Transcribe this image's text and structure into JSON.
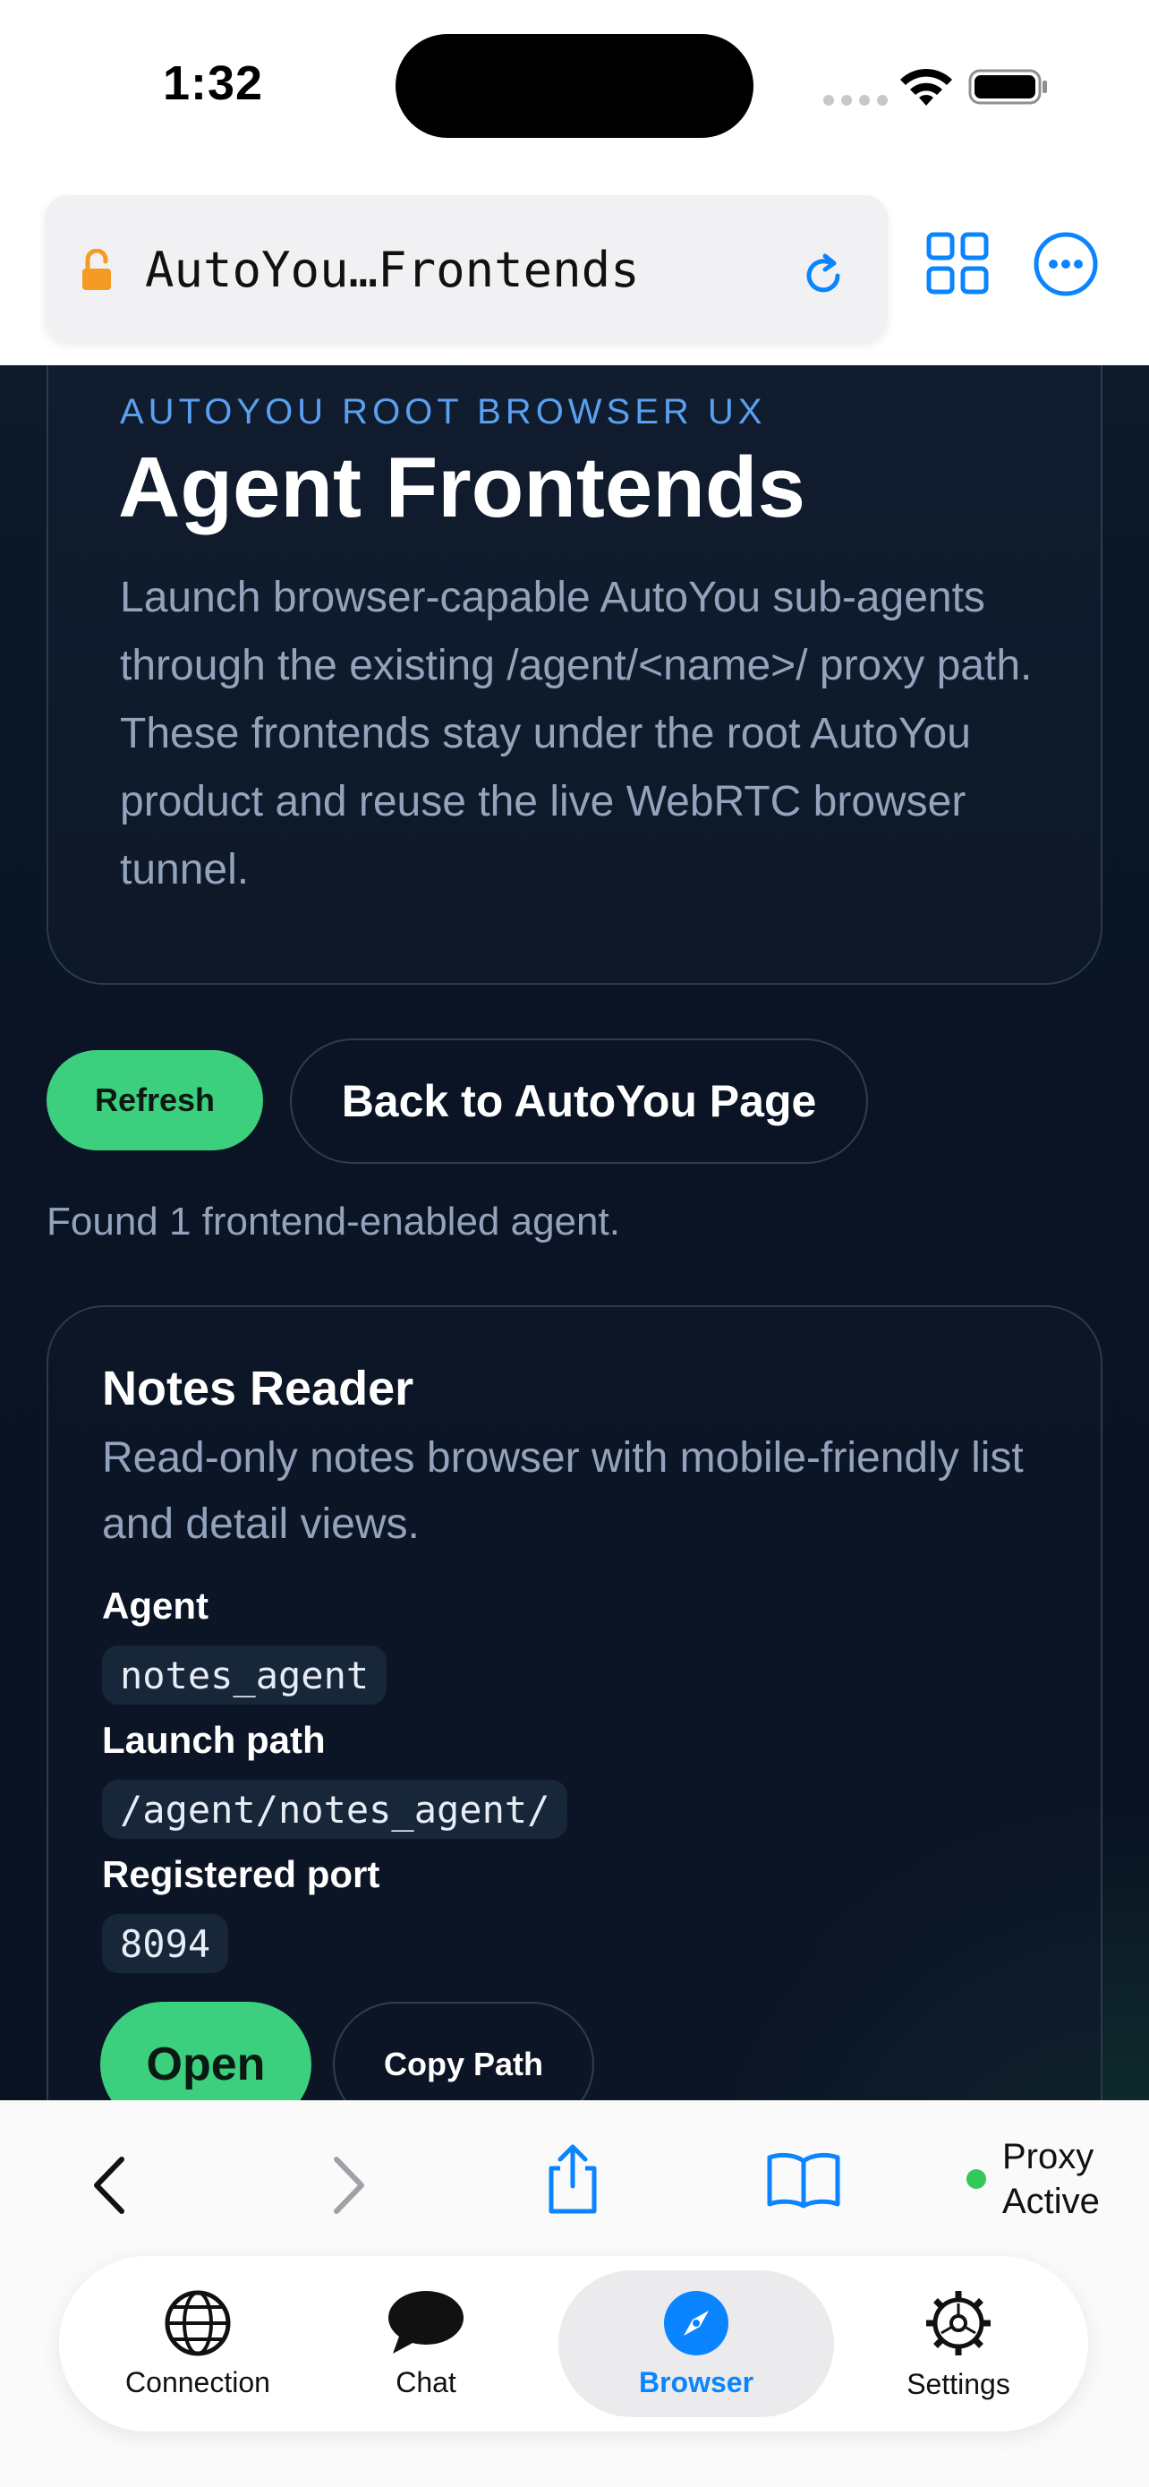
{
  "status_bar": {
    "time": "1:32"
  },
  "url_bar": {
    "url_text": "AutoYou…Frontends"
  },
  "hero": {
    "eyebrow": "AUTOYOU ROOT BROWSER UX",
    "title": "Agent Frontends",
    "description": "Launch browser-capable AutoYou sub-agents through the existing /agent/<name>/ proxy path. These frontends stay under the root AutoYou product and reuse the live WebRTC browser tunnel."
  },
  "actions": {
    "refresh_label": "Refresh",
    "back_label": "Back to AutoYou Page"
  },
  "found_text": "Found 1 frontend-enabled agent.",
  "agent_card": {
    "name": "Notes Reader",
    "description": "Read-only notes browser with mobile-friendly list and detail views.",
    "agent_label": "Agent",
    "agent_value": "notes_agent",
    "launch_path_label": "Launch path",
    "launch_path_value": "/agent/notes_agent/",
    "port_label": "Registered port",
    "port_value": "8094",
    "open_label": "Open",
    "copy_label": "Copy Path"
  },
  "toolbar": {
    "proxy_line1": "Proxy",
    "proxy_line2": "Active",
    "proxy_color": "#34c759"
  },
  "tabbar": {
    "tabs": [
      {
        "label": "Connection",
        "icon": "globe-icon"
      },
      {
        "label": "Chat",
        "icon": "chat-bubble-icon"
      },
      {
        "label": "Browser",
        "icon": "compass-icon",
        "active": true
      },
      {
        "label": "Settings",
        "icon": "gear-icon"
      }
    ]
  },
  "colors": {
    "accent": "#0a84ff",
    "success": "#3ccf7e",
    "background": "#0a1424"
  }
}
